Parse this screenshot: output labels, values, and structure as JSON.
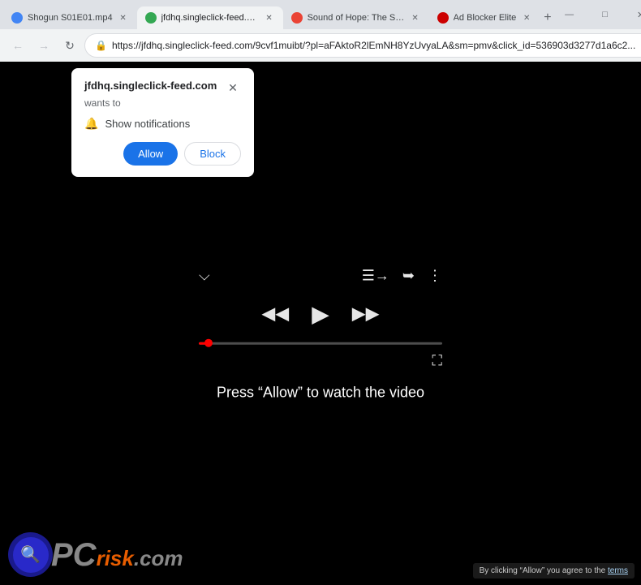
{
  "browser": {
    "tabs": [
      {
        "id": "tab1",
        "title": "Shogun S01E01.mp4",
        "favicon_color": "#4285f4",
        "active": false
      },
      {
        "id": "tab2",
        "title": "jfdhq.singleclick-feed.com",
        "favicon_color": "#34a853",
        "active": true
      },
      {
        "id": "tab3",
        "title": "Sound of Hope: The Story",
        "favicon_color": "#ea4335",
        "active": false
      },
      {
        "id": "tab4",
        "title": "Ad Blocker Elite",
        "favicon_color": "#cc0000",
        "active": false
      }
    ],
    "url": "https://jfdhq.singleclick-feed.com/9cvf1muibt/?pl=aFAktoR2lEmNH8YzUvyaLA&sm=pmv&click_id=536903d3277d1a6c2...",
    "window_controls": {
      "minimize": "—",
      "maximize": "□",
      "close": "✕"
    }
  },
  "notification_popup": {
    "domain": "jfdhq.singleclick-feed.com",
    "wants_to": "wants to",
    "permission_label": "Show notifications",
    "allow_label": "Allow",
    "block_label": "Block"
  },
  "video_player": {
    "message": "Press “Allow” to watch the video",
    "progress_percent": 4
  },
  "disclaimer": {
    "text": "By clicking “Allow” you agree to the",
    "link_text": "terms"
  },
  "pcrisk": {
    "pc_text": "PC",
    "risk_text": "risk",
    "com_text": ".com"
  }
}
